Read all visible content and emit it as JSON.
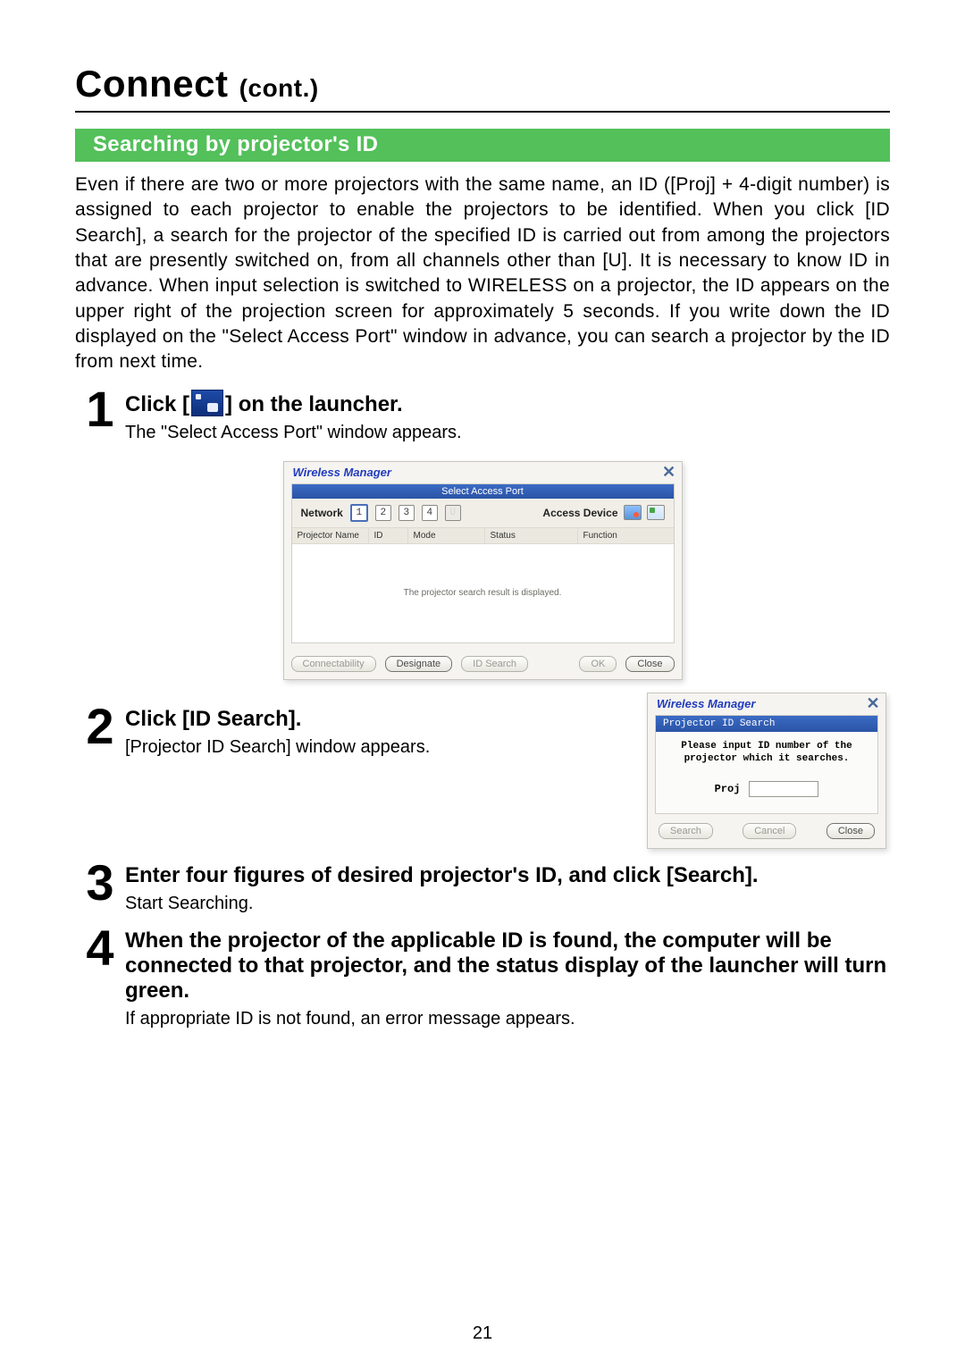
{
  "page_number": "21",
  "title_main": "Connect",
  "title_cont": "(cont.)",
  "section_header": "Searching by projector's ID",
  "intro_para": "Even if there are two or more projectors with the same name, an ID ([Proj] + 4-digit number) is assigned to each projector to enable the projectors to be identified. When you click [ID Search], a search for the projector of the specified ID is carried out from among the projectors that are presently switched on, from all channels other than [U]. It is necessary to know ID in advance. When input selection is switched to WIRELESS on a projector, the ID appears on the upper right of the projection screen for approximately 5 seconds. If you write down the ID displayed on the \"Select Access Port\" window in advance, you can search a projector by the ID from next time.",
  "steps": {
    "s1": {
      "num": "1",
      "head_prefix": "Click [",
      "head_suffix": "] on the launcher.",
      "desc": "The \"Select Access Port\" window appears."
    },
    "s2": {
      "num": "2",
      "head": "Click [ID Search].",
      "desc": "[Projector ID Search] window appears."
    },
    "s3": {
      "num": "3",
      "head": "Enter four figures of desired projector's ID, and click [Search].",
      "desc": "Start Searching."
    },
    "s4": {
      "num": "4",
      "head": "When the projector of the applicable ID is found, the computer will be connected to that projector, and the status display of the launcher will turn green.",
      "desc": "If appropriate ID is not found, an error message appears."
    }
  },
  "sap": {
    "manager": "Wireless Manager",
    "window_title": "Select Access Port",
    "network_label": "Network",
    "access_device_label": "Access Device",
    "channels": [
      "1",
      "2",
      "3",
      "4",
      "U"
    ],
    "columns": {
      "c0": "Projector Name",
      "c1": "ID",
      "c2": "Mode",
      "c3": "Status",
      "c4": "Function"
    },
    "empty_msg": "The projector search result is displayed.",
    "buttons": {
      "connectability": "Connectability",
      "designate": "Designate",
      "id_search": "ID Search",
      "ok": "OK",
      "close": "Close"
    }
  },
  "pid": {
    "manager": "Wireless Manager",
    "title": "Projector ID Search",
    "msg": "Please input ID number of the projector which it searches.",
    "proj_label": "Proj",
    "buttons": {
      "search": "Search",
      "cancel": "Cancel",
      "close": "Close"
    }
  }
}
